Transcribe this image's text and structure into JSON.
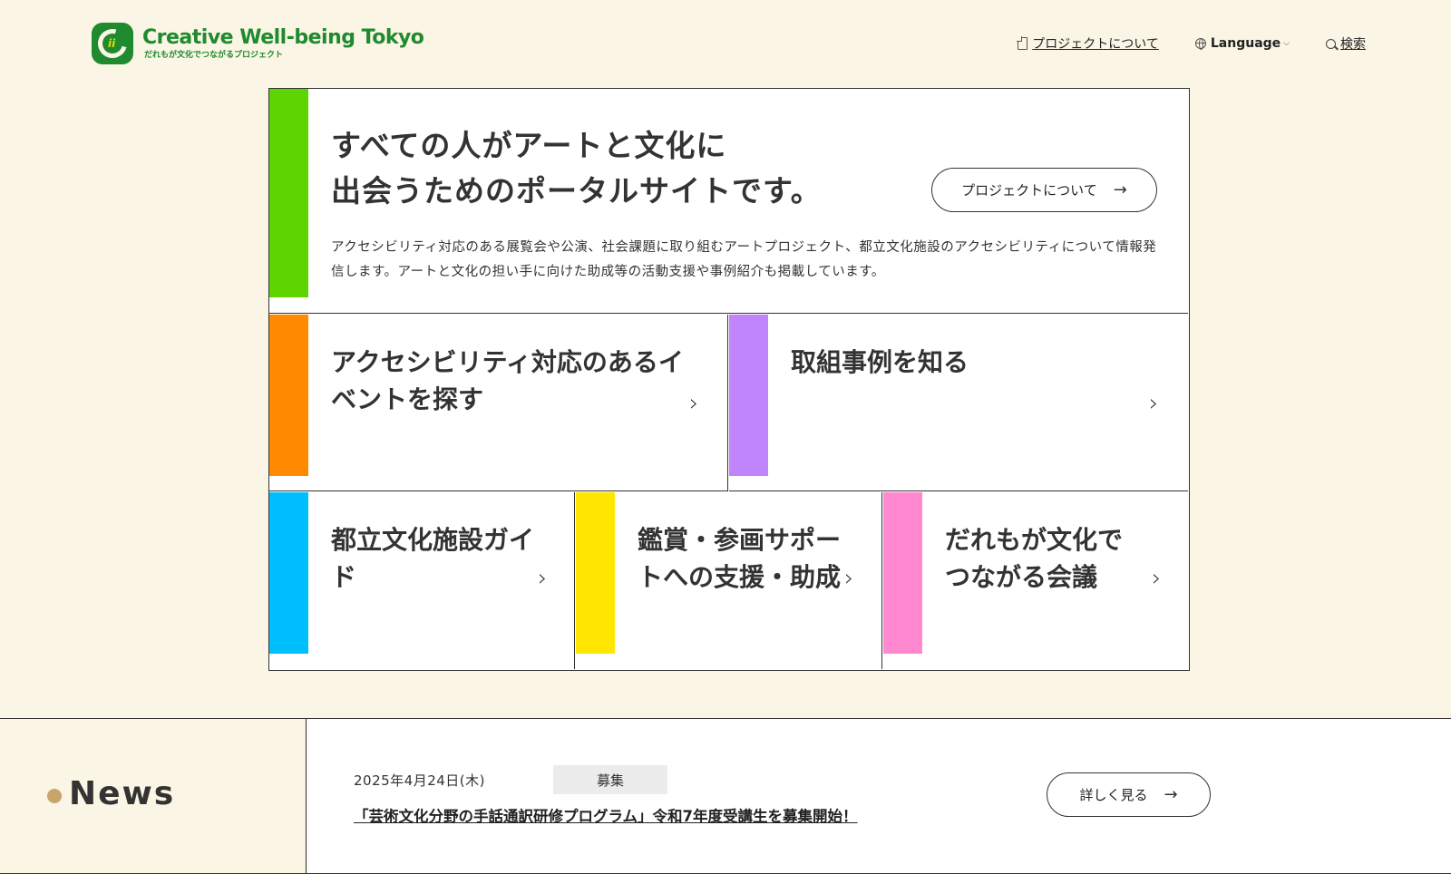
{
  "header": {
    "logo_title": "Creative Well-being Tokyo",
    "logo_sub": "だれもが文化でつながるプロジェクト",
    "logo_mark_letters": "ii",
    "nav": {
      "about": "プロジェクトについて",
      "language": "Language",
      "search": "検索"
    }
  },
  "hero": {
    "title_line1": "すべての人がアートと文化に",
    "title_line2": "出会うためのポータルサイトです。",
    "button_label": "プロジェクトについて",
    "description": "アクセシビリティ対応のある展覧会や公演、社会課題に取り組むアートプロジェクト、都立文化施設のアクセシビリティについて情報発信します。アートと文化の担い手に向けた助成等の活動支援や事例紹介も掲載しています。"
  },
  "tiles": [
    {
      "line1": "アクセシビリティ対応のあるイ",
      "line2": "ベントを探す",
      "color": "#ff8a00"
    },
    {
      "line1": "取組事例を知る",
      "line2": "",
      "color": "#c084fc"
    },
    {
      "line1": "都立文化施設ガイ",
      "line2": "ド",
      "color": "#00bfff"
    },
    {
      "line1": "鑑賞・参画サポー",
      "line2": "トへの支援・助成",
      "color": "#ffe600"
    },
    {
      "line1": "だれもが文化で",
      "line2": "つながる会議",
      "color": "#ff88d0"
    }
  ],
  "news": {
    "heading": "News",
    "date": "2025年4月24日(木)",
    "tag": "募集",
    "link": "「芸術文化分野の手話通訳研修プログラム」令和7年度受講生を募集開始！",
    "button_label": "詳しく見る"
  }
}
